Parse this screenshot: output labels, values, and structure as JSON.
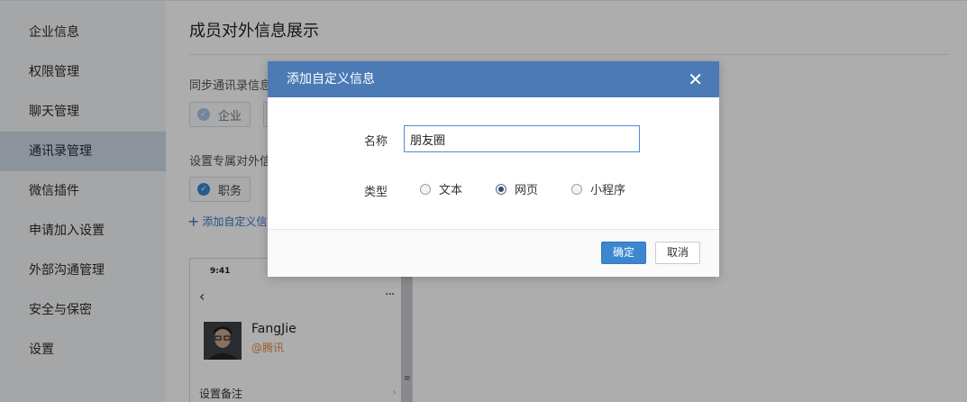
{
  "sidebar": {
    "items": [
      {
        "label": "企业信息"
      },
      {
        "label": "权限管理"
      },
      {
        "label": "聊天管理"
      },
      {
        "label": "通讯录管理",
        "active": true
      },
      {
        "label": "微信插件"
      },
      {
        "label": "申请加入设置"
      },
      {
        "label": "外部沟通管理"
      },
      {
        "label": "安全与保密"
      },
      {
        "label": "设置"
      }
    ]
  },
  "main": {
    "title": "成员对外信息展示",
    "sync_label": "同步通讯录信息",
    "sync_chip": "企业",
    "custom_label": "设置专属对外信息",
    "custom_chip": "职务",
    "add_link": "添加自定义信息",
    "add_icon": "plus-icon"
  },
  "phone": {
    "time": "9:41",
    "back_icon": "chevron-left-icon",
    "more_icon": "more-icon",
    "name": "FangJie",
    "corp": "@腾讯",
    "note": "设置备注"
  },
  "dialog": {
    "title": "添加自定义信息",
    "close_icon": "close-icon",
    "name_label": "名称",
    "name_value": "朋友圈",
    "type_label": "类型",
    "types": [
      {
        "label": "文本",
        "checked": false
      },
      {
        "label": "网页",
        "checked": true
      },
      {
        "label": "小程序",
        "checked": false
      }
    ],
    "ok_label": "确定",
    "cancel_label": "取消"
  },
  "colors": {
    "accent": "#3c86d0",
    "dialog_header": "#4b7ab5",
    "sidebar_active": "#d0d9e5",
    "corp_text": "#e28b4b"
  }
}
